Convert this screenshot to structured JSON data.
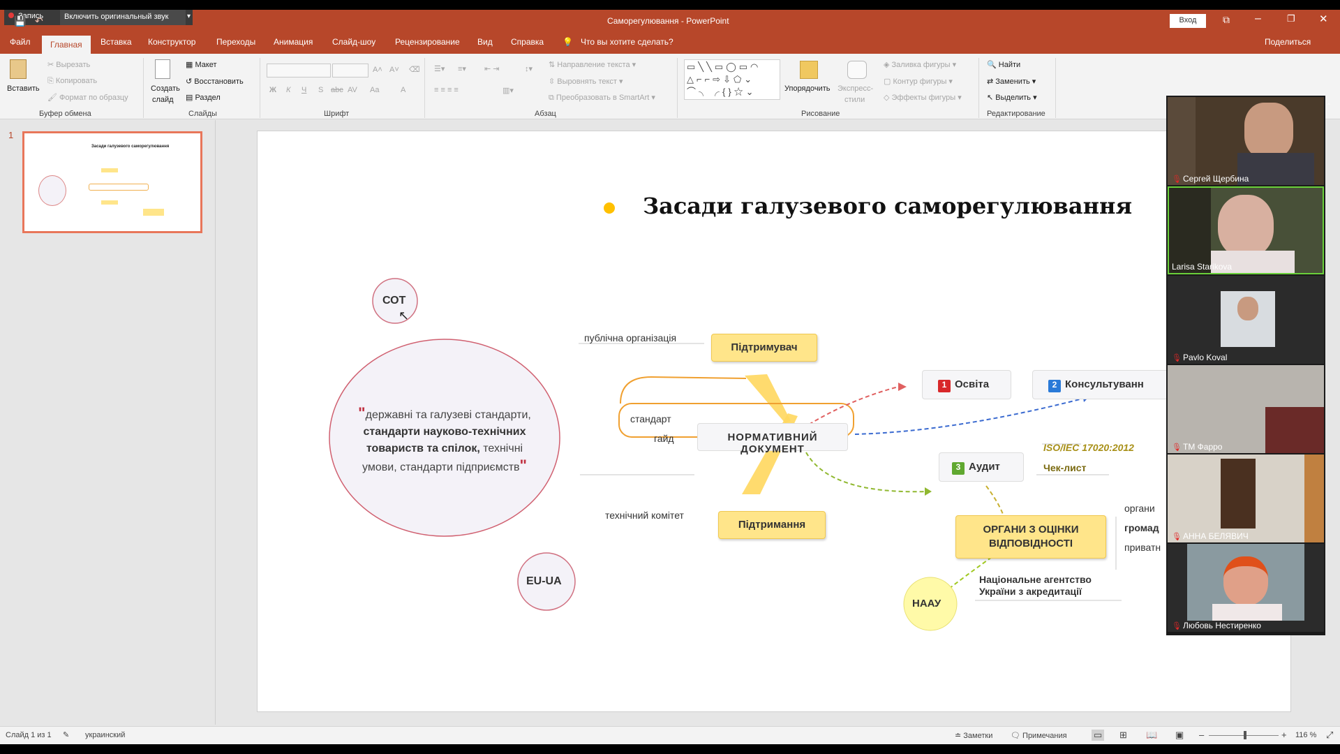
{
  "overlay": {
    "record_label": "Запись",
    "audio_button": "Включить оригинальный звук"
  },
  "window": {
    "title": "Саморегулювання - PowerPoint",
    "signin": "Вход"
  },
  "tabs": [
    "Файл",
    "Главная",
    "Вставка",
    "Конструктор",
    "Переходы",
    "Анимация",
    "Слайд-шоу",
    "Рецензирование",
    "Вид",
    "Справка"
  ],
  "tell_me": "Что вы хотите сделать?",
  "share": "Поделиться",
  "ribbon": {
    "clipboard": {
      "paste": "Вставить",
      "cut": "Вырезать",
      "copy": "Копировать",
      "format_painter": "Формат по образцу",
      "label": "Буфер обмена"
    },
    "slides": {
      "new_slide_1": "Создать",
      "new_slide_2": "слайд",
      "layout": "Макет",
      "reset": "Восстановить",
      "section": "Раздел",
      "label": "Слайды"
    },
    "font": {
      "bold": "Ж",
      "italic": "К",
      "underline": "Ч",
      "strike": "S",
      "spacing": "abc",
      "av": "AV",
      "case": "Aa",
      "color": "A",
      "label": "Шрифт"
    },
    "paragraph": {
      "text_direction": "Направление текста",
      "align_text": "Выровнять текст",
      "smartart": "Преобразовать в SmartArt",
      "label": "Абзац"
    },
    "drawing": {
      "arrange": "Упорядочить",
      "quick_styles_1": "Экспресс-",
      "quick_styles_2": "стили",
      "fill": "Заливка фигуры",
      "outline": "Контур фигуры",
      "effects": "Эффекты фигуры",
      "label": "Рисование"
    },
    "editing": {
      "find": "Найти",
      "replace": "Заменить",
      "select": "Выделить",
      "label": "Редактирование"
    }
  },
  "thumbnail": {
    "number": "1",
    "title": "Засади галузевого саморегулювання"
  },
  "slide": {
    "title": "Засади галузевого саморегулювання",
    "cot": "СОТ",
    "eu_ua": "EU-UA",
    "standards_1": "державні та галузеві стандарти,",
    "standards_2": "стандарти науково-технічних",
    "standards_3": "товариств та спілок,",
    "standards_3b": " технічні",
    "standards_4": "умови, стандарти підприємств",
    "public_org": "публічна організація",
    "supporter": "Підтримувач",
    "standard": "стандарт",
    "guide": "гайд",
    "normative": "НОРМАТИВНИЙ ДОКУМЕНТ",
    "tech_committee": "технічний комітет",
    "maintenance": "Підтримання",
    "education_num": "1",
    "education": "Освіта",
    "consult_num": "2",
    "consult": "Консультуванн",
    "audit_num": "3",
    "audit": "Аудит",
    "iso": "ISO/IEC 17020:2012",
    "checklist": "Чек-лист",
    "bodies_1": "ОРГАНИ З ОЦІНКИ",
    "bodies_2": "ВІДПОВІДНОСТІ",
    "organs": "органи",
    "public": "громад",
    "private": "приватн",
    "naau": "НААУ",
    "naau_full_1": "Національне агентство",
    "naau_full_2": "України з акредитації"
  },
  "participants": [
    {
      "name": "Сергей Щербина",
      "muted": true
    },
    {
      "name": "Larisa Starikova",
      "muted": false
    },
    {
      "name": "Pavlo Koval",
      "muted": true
    },
    {
      "name": "TM Фарро",
      "muted": true
    },
    {
      "name": "АННА БЕЛЯВИЧ",
      "muted": true
    },
    {
      "name": "Любовь Нестиренко",
      "muted": true
    }
  ],
  "status": {
    "slide_info": "Слайд 1 из 1",
    "language": "украинский",
    "notes": "Заметки",
    "comments": "Примечания",
    "zoom": "116 %"
  }
}
